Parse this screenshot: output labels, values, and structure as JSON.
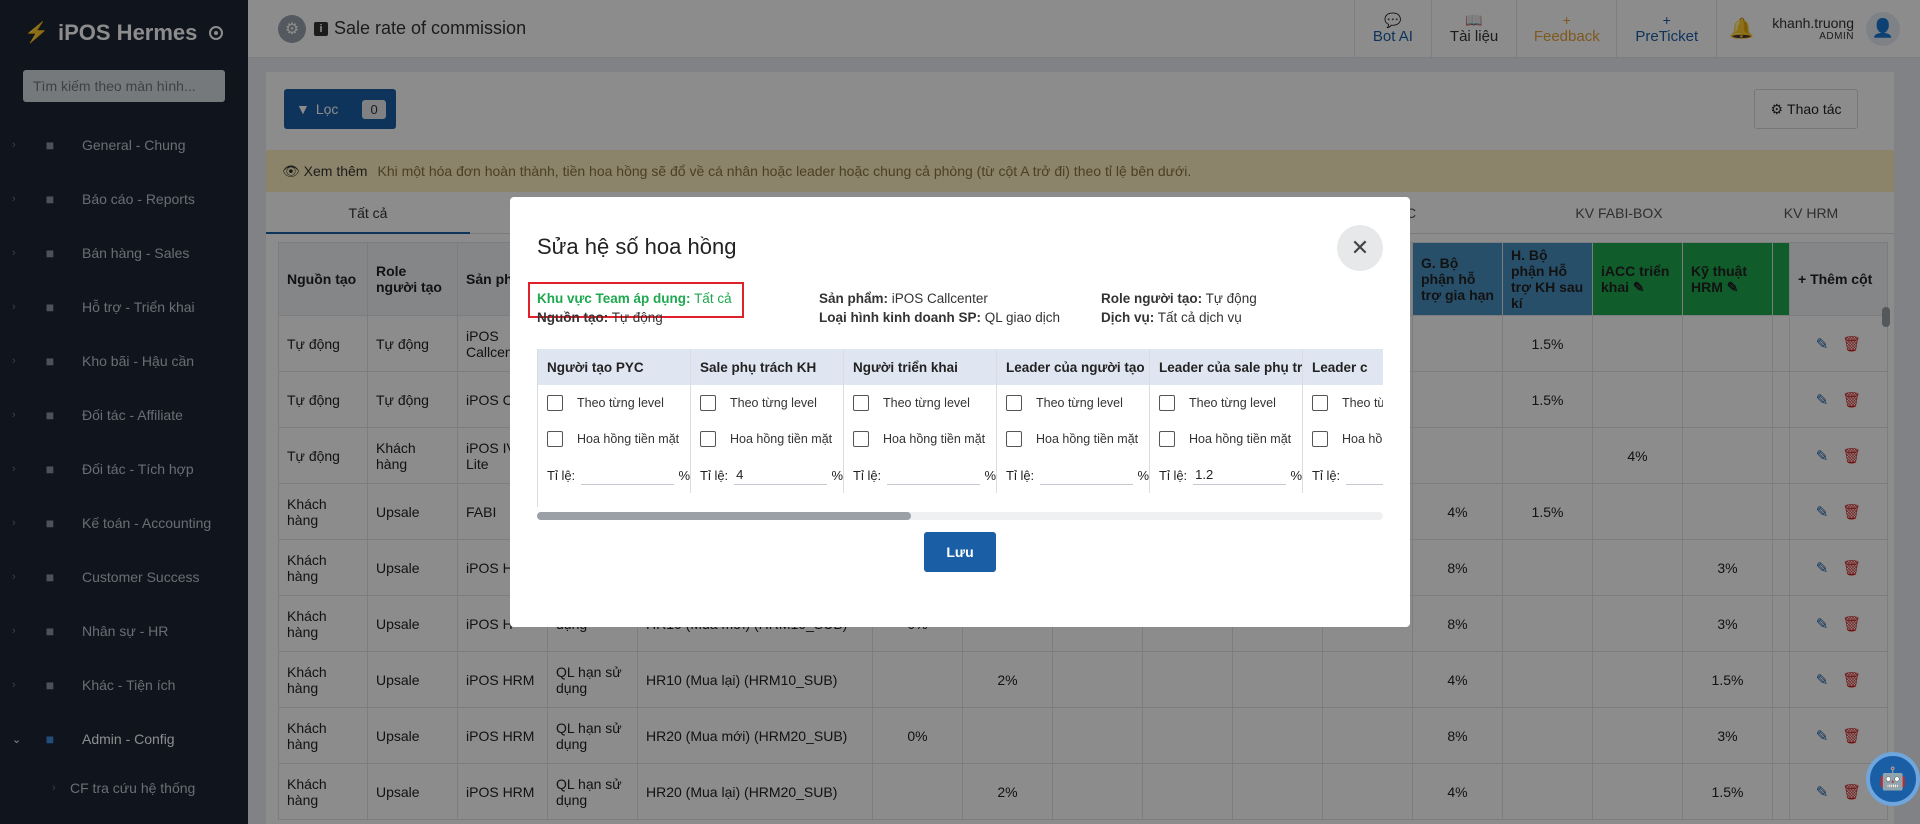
{
  "app": {
    "name": "iPOS Hermes",
    "search_placeholder": "Tìm kiếm theo màn hình..."
  },
  "sidebar": {
    "items": [
      {
        "label": "General - Chung",
        "icon": "home-icon"
      },
      {
        "label": "Báo cáo - Reports",
        "icon": "chart-icon"
      },
      {
        "label": "Bán hàng - Sales",
        "icon": "dollar-icon"
      },
      {
        "label": "Hỗ trợ - Triển khai",
        "icon": "help-icon"
      },
      {
        "label": "Kho bãi - Hậu cần",
        "icon": "list-icon"
      },
      {
        "label": "Đối tác - Affiliate",
        "icon": "network-icon"
      },
      {
        "label": "Đối tác - Tích hợp",
        "icon": "network-icon"
      },
      {
        "label": "Kế toán - Accounting",
        "icon": "ledger-icon"
      },
      {
        "label": "Customer Success",
        "icon": "id-card-icon"
      },
      {
        "label": "Nhân sự - HR",
        "icon": "people-icon"
      },
      {
        "label": "Khác - Tiện ích",
        "icon": "monitor-icon"
      },
      {
        "label": "Admin - Config",
        "icon": "gear-icon"
      }
    ],
    "sub_item": "CF tra cứu hệ thống"
  },
  "topbar": {
    "page_title": "Sale rate of commission",
    "bot_ai": "Bot AI",
    "docs": "Tài liệu",
    "feedback": "Feedback",
    "preticket": "PreTicket",
    "user_name": "khanh.truong",
    "user_role": "ADMIN"
  },
  "toolbar": {
    "filter_label": "Lọc",
    "filter_count": "0",
    "action_label": "Thao tác"
  },
  "notice": {
    "more": "Xem thêm",
    "text": "Khi một hóa đơn hoàn thành, tiền hoa hồng sẽ đổ về cá nhân hoặc leader hoặc chung cả phòng (từ cột A trở đi) theo tỉ lệ bên dưới."
  },
  "tabs": [
    "Tất cả",
    "KV FABI-BOX",
    "KV HRM"
  ],
  "tab_hidden_fragment": "C",
  "table": {
    "headers_left": [
      "Nguồn tạo",
      "Role người tạo",
      "Sản phẩm"
    ],
    "headers_right": [
      "G. Bộ phận hỗ trợ gia hạn",
      "H. Bộ phận Hỗ trợ KH sau kí",
      "iACC triển khai",
      "Kỹ thuật HRM"
    ],
    "add_column": "Thêm cột",
    "rows": [
      {
        "src": "Tự động",
        "role": "Tự động",
        "prod": "iPOS Callcenter",
        "g": "",
        "h": "1.5%",
        "iacc": "",
        "hrm": ""
      },
      {
        "src": "Tự động",
        "role": "Tự động",
        "prod": "iPOS CI",
        "g": "",
        "h": "1.5%",
        "iacc": "",
        "hrm": ""
      },
      {
        "src": "Tự động",
        "role": "Khách hàng",
        "prod": "iPOS IV Lite",
        "g": "",
        "h": "",
        "iacc": "4%",
        "hrm": ""
      },
      {
        "src": "Khách hàng",
        "role": "Upsale",
        "prod": "FABI",
        "g": "4%",
        "h": "1.5%",
        "iacc": "",
        "hrm": ""
      },
      {
        "src": "Khách hàng",
        "role": "Upsale",
        "prod": "iPOS H",
        "g": "8%",
        "h": "",
        "iacc": "",
        "hrm": "3%"
      },
      {
        "src": "Khách hàng",
        "role": "Upsale",
        "prod": "iPOS H",
        "g": "8%",
        "h": "",
        "iacc": "",
        "hrm": "3%"
      },
      {
        "src": "Khách hàng",
        "role": "Upsale",
        "prod": "iPOS HRM",
        "g": "4%",
        "h": "",
        "iacc": "",
        "hrm": "1.5%"
      },
      {
        "src": "Khách hàng",
        "role": "Upsale",
        "prod": "iPOS HRM",
        "g": "8%",
        "h": "",
        "iacc": "",
        "hrm": "3%"
      },
      {
        "src": "Khách hàng",
        "role": "Upsale",
        "prod": "iPOS HRM",
        "g": "4%",
        "h": "",
        "iacc": "",
        "hrm": "1.5%"
      }
    ],
    "visible_mid": [
      {
        "type": "",
        "name": "",
        "a": "",
        "b": ""
      },
      {
        "type": "",
        "name": "",
        "a": "",
        "b": ""
      },
      {
        "type": "",
        "name": "",
        "a": "",
        "b": ""
      },
      {
        "type": "",
        "name": "",
        "a": "",
        "b": ""
      },
      {
        "type": "",
        "name": "",
        "a": "",
        "b": ""
      },
      {
        "type": "dụng",
        "name": "HR10 (Mua mới) (HRM10_SUB)",
        "a": "0%",
        "b": ""
      },
      {
        "type": "QL hạn sử dụng",
        "name": "HR10 (Mua lại) (HRM10_SUB)",
        "a": "",
        "b": "2%"
      },
      {
        "type": "QL hạn sử dụng",
        "name": "HR20 (Mua mới) (HRM20_SUB)",
        "a": "0%",
        "b": ""
      },
      {
        "type": "QL hạn sử dụng",
        "name": "HR20 (Mua lại) (HRM20_SUB)",
        "a": "",
        "b": "2%"
      }
    ]
  },
  "modal": {
    "title": "Sửa hệ số hoa hồng",
    "area_label": "Khu vực Team áp dụng:",
    "area_value": "Tất cả",
    "source_label": "Nguồn tạo:",
    "source_value": "Tự động",
    "product_label": "Sản phẩm:",
    "product_value": "iPOS Callcenter",
    "biz_label": "Loại hình kinh doanh SP:",
    "biz_value": "QL giao dịch",
    "role_label": "Role người tạo:",
    "role_value": "Tự động",
    "service_label": "Dịch vụ:",
    "service_value": "Tất cả dịch vụ",
    "check_level": "Theo từng level",
    "check_cash": "Hoa hồng tiền mặt",
    "ratio_label": "Tỉ lệ:",
    "percent": "%",
    "columns": [
      {
        "header": "Người tạo PYC",
        "ratio": ""
      },
      {
        "header": "Sale phụ trách KH",
        "ratio": "4"
      },
      {
        "header": "Người triển khai",
        "ratio": ""
      },
      {
        "header": "Leader của người tạo",
        "ratio": ""
      },
      {
        "header": "Leader của sale phụ trách",
        "ratio": "1.2"
      },
      {
        "header": "Leader c",
        "ratio": ""
      }
    ],
    "save_label": "Lưu"
  },
  "colors": {
    "sidebar_bg": "#1c2536",
    "primary": "#1a5fa6",
    "highlight_border": "#e0212b",
    "green_text": "#1ea84f",
    "notice_bg": "#fdf0c2"
  }
}
